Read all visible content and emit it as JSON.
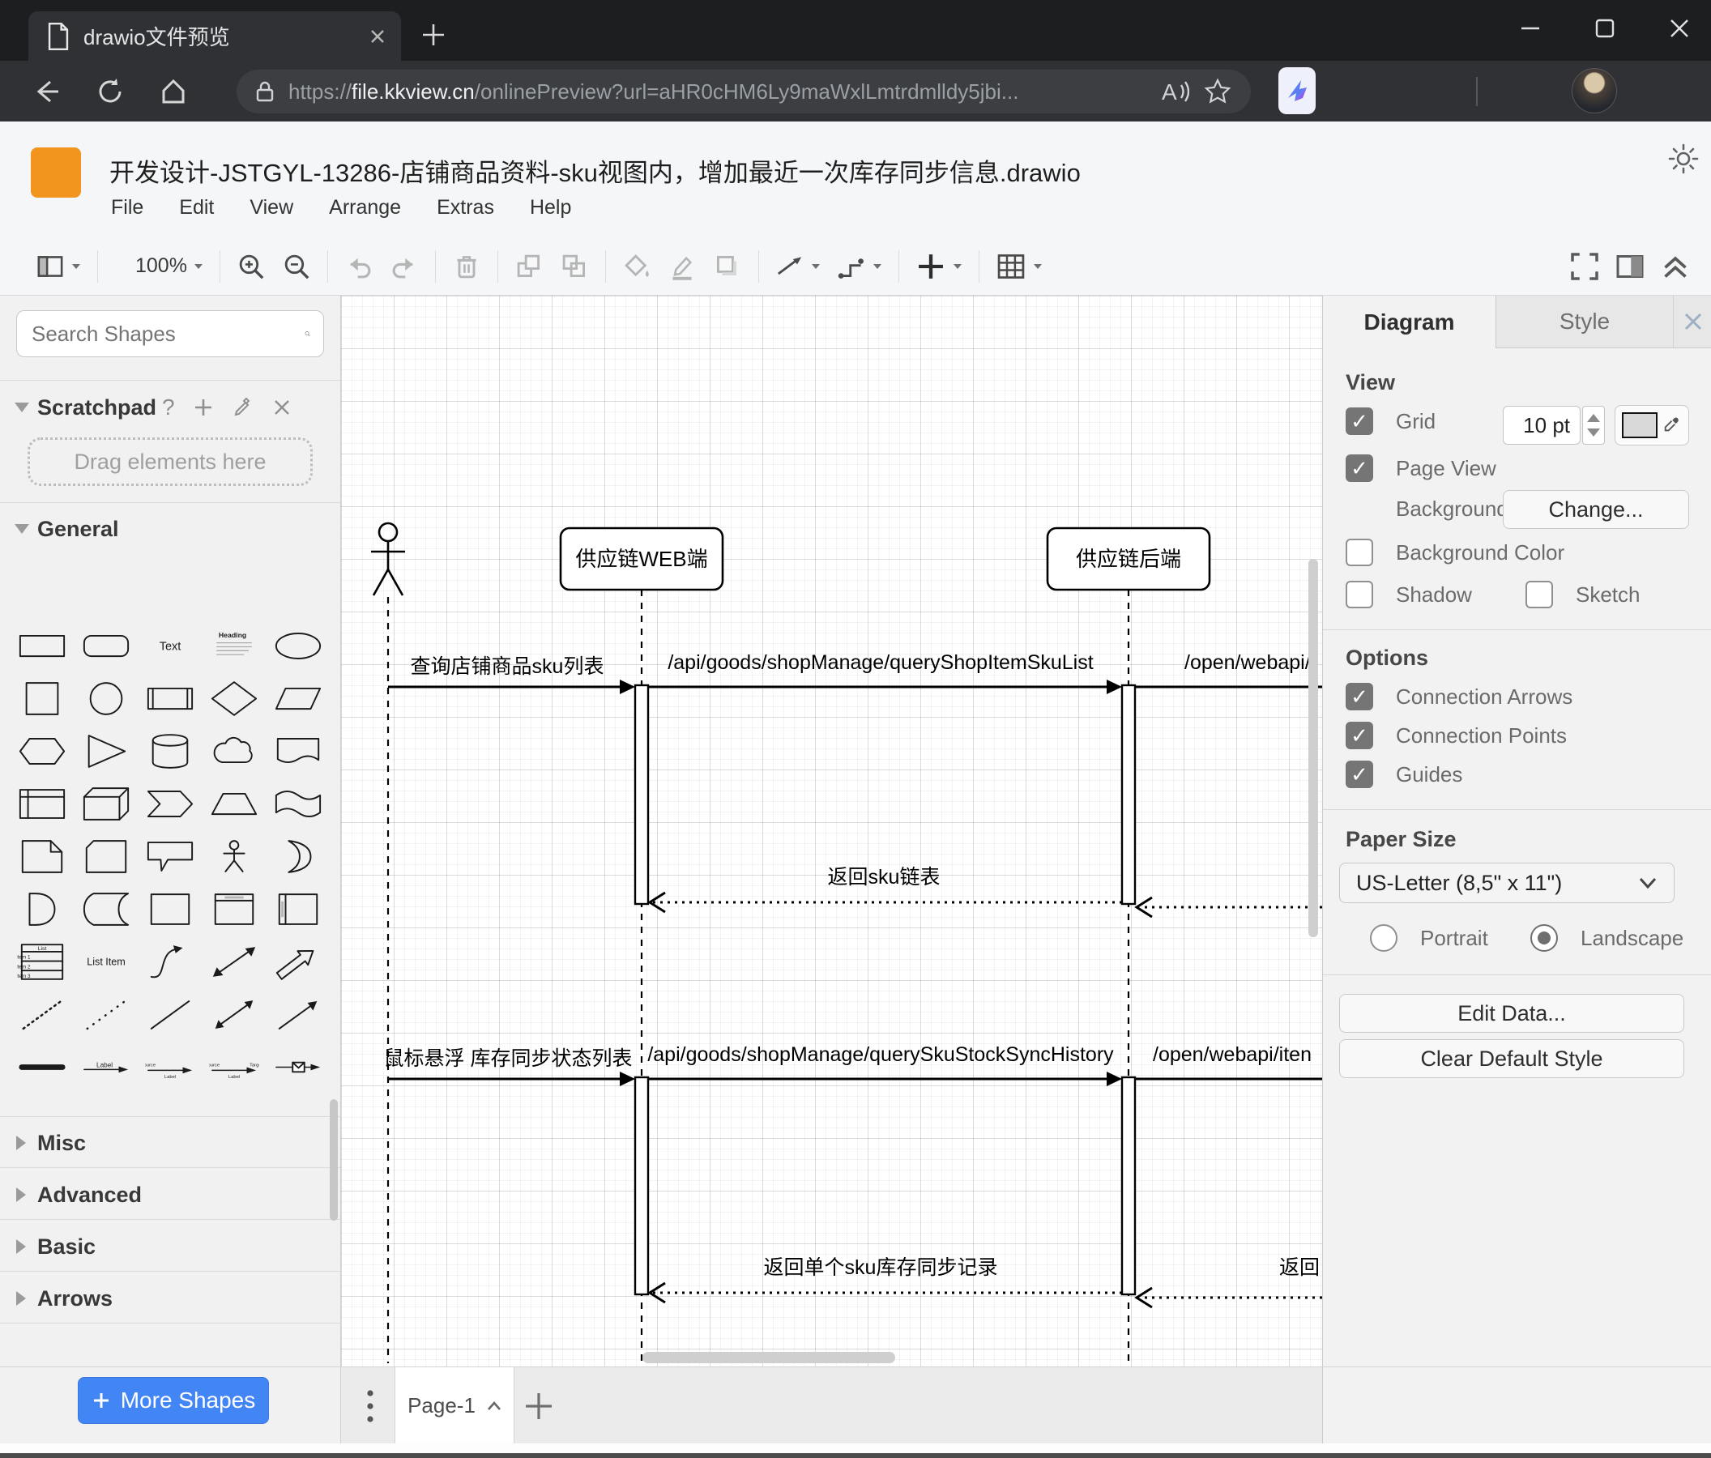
{
  "browser": {
    "tab_title": "drawio文件预览",
    "url": {
      "protocol": "https://",
      "domain": "file.kkview.cn",
      "path": "/onlinePreview?url=aHR0cHM6Ly9maWxlLmtrdmlldy5jbi..."
    }
  },
  "header": {
    "title": "开发设计-JSTGYL-13286-店铺商品资料-sku视图内，增加最近一次库存同步信息.drawio",
    "menus": [
      "File",
      "Edit",
      "View",
      "Arrange",
      "Extras",
      "Help"
    ]
  },
  "toolbar": {
    "zoom_level": "100%"
  },
  "sidebar": {
    "search_placeholder": "Search Shapes",
    "scratchpad": {
      "title": "Scratchpad",
      "hint": "Drag elements here"
    },
    "general_title": "General",
    "collapsed_sections": [
      "Misc",
      "Advanced",
      "Basic",
      "Arrows"
    ],
    "more_shapes_label": "More Shapes",
    "shape_texts": {
      "text": "Text",
      "heading": "Heading",
      "list": "List",
      "item1": "Item 1",
      "item2": "Item 2",
      "item3": "Item 3",
      "list_item": "List Item",
      "label": "Label",
      "source": "Source",
      "target": "Target"
    },
    "shapes": [
      "rectangle",
      "rounded-rectangle",
      "text",
      "heading",
      "ellipse",
      "square",
      "circle",
      "process",
      "diamond",
      "parallelogram",
      "hexagon",
      "triangle",
      "cylinder",
      "cloud",
      "document",
      "internal-storage",
      "cube",
      "step",
      "trapezoid",
      "tape",
      "note",
      "card",
      "callout",
      "actor",
      "or",
      "and",
      "data-storage",
      "container",
      "vertical-container",
      "horizontal-container",
      "list",
      "list-item",
      "curve",
      "bidirectional-arrow",
      "arrow",
      "dashed-line",
      "dotted-line",
      "line",
      "bidirectional-connector",
      "directional-connector",
      "link",
      "arrow-with-label",
      "arrow-source-label",
      "arrow-source-label-target",
      "message-arrow"
    ]
  },
  "canvas": {
    "lifelines": [
      {
        "type": "actor"
      },
      {
        "label": "供应链WEB端"
      },
      {
        "label": "供应链后端"
      }
    ],
    "messages": {
      "m1": "查询店铺商品sku列表",
      "m2": "/api/goods/shopManage/queryShopItemSkuList",
      "m3": "/open/webapi/",
      "r1": "返回sku链表",
      "m4": "鼠标悬浮 库存同步状态列表",
      "m5": "/api/goods/shopManage/querySkuStockSyncHistory",
      "m6": "/open/webapi/iten",
      "r2": "返回单个sku库存同步记录",
      "r3": "返回"
    },
    "page_tab": "Page-1"
  },
  "panel": {
    "tabs": {
      "diagram": "Diagram",
      "style": "Style"
    },
    "view": {
      "title": "View",
      "grid": "Grid",
      "grid_size": "10 pt",
      "page_view": "Page View",
      "background": "Background",
      "change_button": "Change...",
      "background_color": "Background Color",
      "shadow": "Shadow",
      "sketch": "Sketch"
    },
    "options": {
      "title": "Options",
      "items": [
        "Connection Arrows",
        "Connection Points",
        "Guides"
      ]
    },
    "paper": {
      "title": "Paper Size",
      "size_value": "US-Letter (8,5\" x 11\")",
      "portrait": "Portrait",
      "landscape": "Landscape"
    },
    "buttons": {
      "edit_data": "Edit Data...",
      "clear_default": "Clear Default Style"
    }
  },
  "colors": {
    "accent_blue": "#4285f4",
    "logo_orange": "#f2951f",
    "chrome_dark": "#1d1e20",
    "panel_gray": "#f2f2f3",
    "checked_checkbox": "#757575",
    "diagram_stroke": "#000000"
  }
}
